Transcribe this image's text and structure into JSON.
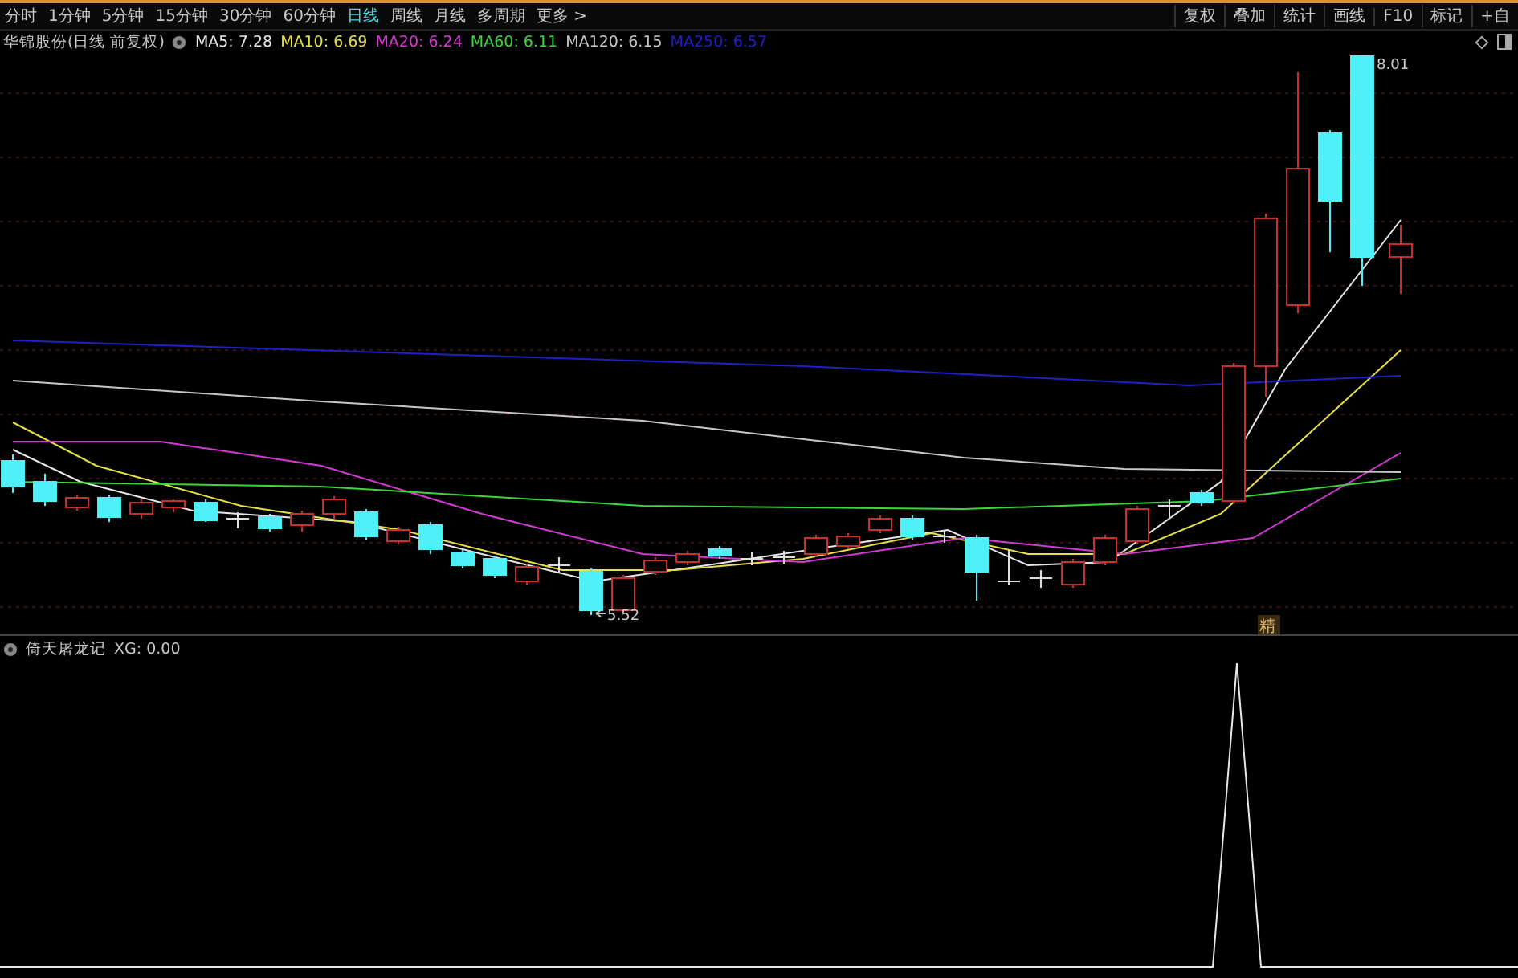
{
  "toolbar": {
    "periods": [
      {
        "label": "分时",
        "selected": false
      },
      {
        "label": "1分钟",
        "selected": false
      },
      {
        "label": "5分钟",
        "selected": false
      },
      {
        "label": "15分钟",
        "selected": false
      },
      {
        "label": "30分钟",
        "selected": false
      },
      {
        "label": "60分钟",
        "selected": false
      },
      {
        "label": "日线",
        "selected": true
      },
      {
        "label": "周线",
        "selected": false
      },
      {
        "label": "月线",
        "selected": false
      },
      {
        "label": "多周期",
        "selected": false
      },
      {
        "label": "更多 >",
        "selected": false
      }
    ],
    "actions": [
      "复权",
      "叠加",
      "统计",
      "画线",
      "F10",
      "标记",
      "+自"
    ]
  },
  "main_chart": {
    "title": "华锦股份(日线 前复权)",
    "ma": [
      {
        "text": "MA5: 7.28",
        "color": "#e8e8e8"
      },
      {
        "text": "MA10: 6.69",
        "color": "#e6e04a"
      },
      {
        "text": "MA20: 6.24",
        "color": "#d63ad6"
      },
      {
        "text": "MA60: 6.11",
        "color": "#3ed63e"
      },
      {
        "text": "MA120: 6.15",
        "color": "#c8c8c8"
      },
      {
        "text": "MA250: 6.57",
        "color": "#2020c8"
      }
    ],
    "low_label": "5.52",
    "high_label": "8.01",
    "badge": "精"
  },
  "indicator": {
    "title": "倚天屠龙记",
    "reading": "XG: 0.00"
  }
}
